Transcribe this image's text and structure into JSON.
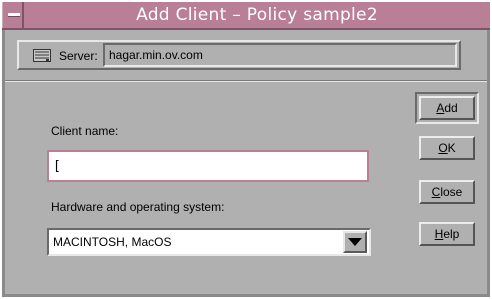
{
  "window": {
    "title": "Add Client – Policy sample2"
  },
  "server": {
    "label": "Server:",
    "value": "hagar.min.ov.com",
    "icon": "server-icon"
  },
  "form": {
    "client_name_label": "Client name:",
    "client_name_value": "[",
    "hw_os_label": "Hardware and operating system:",
    "hw_os_selected": "MACINTOSH, MacOS"
  },
  "buttons": {
    "add": {
      "mnemonic": "A",
      "rest": "dd"
    },
    "ok": {
      "mnemonic": "O",
      "rest": "K"
    },
    "close": {
      "mnemonic": "C",
      "rest": "lose"
    },
    "help": {
      "mnemonic": "H",
      "rest": "elp"
    }
  },
  "colors": {
    "titlebar": "#b87f97",
    "dialog_bg": "#b0b0b0",
    "focus_border": "#b87f97"
  }
}
